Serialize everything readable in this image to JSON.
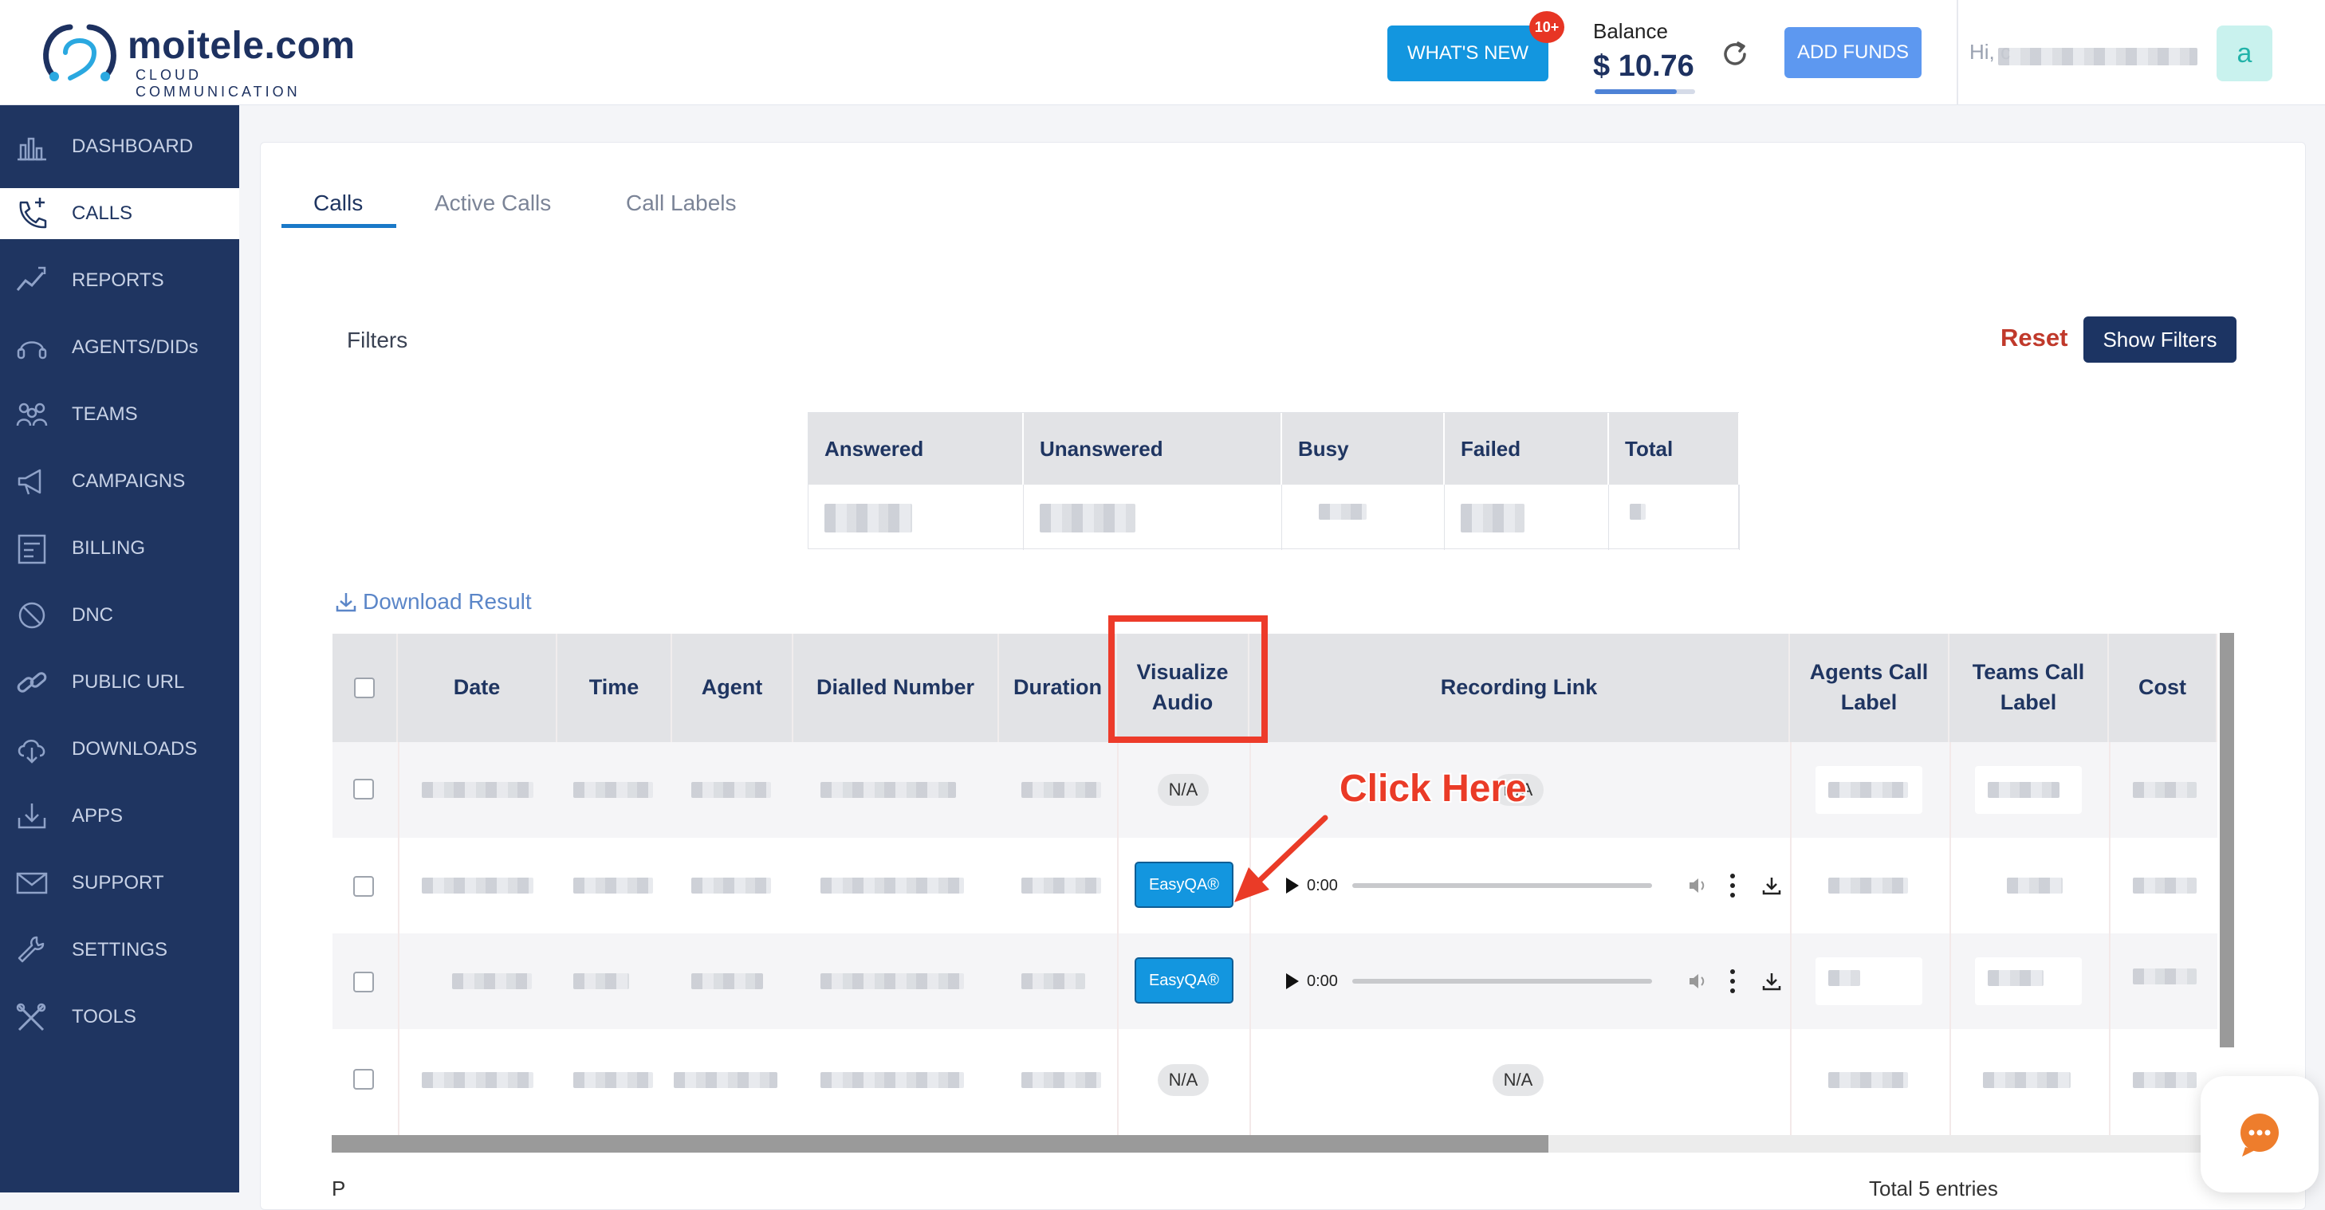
{
  "header": {
    "logo_text": "moitele.com",
    "logo_sub": "CLOUD COMMUNICATION",
    "whats_new": "WHAT'S NEW",
    "whats_new_badge": "10+",
    "balance_label": "Balance",
    "balance_value": "$ 10.76",
    "balance_fill": 0.82,
    "add_funds": "ADD FUNDS",
    "greeting": "Hi, c",
    "avatar_letter": "a",
    "brand_color": "#1f3561",
    "accent_color": "#1396df"
  },
  "sidebar": {
    "items": [
      {
        "label": "DASHBOARD",
        "icon": "dashboard-icon"
      },
      {
        "label": "CALLS",
        "icon": "phone-icon",
        "active": true
      },
      {
        "label": "REPORTS",
        "icon": "reports-icon"
      },
      {
        "label": "AGENTS/DIDs",
        "icon": "headset-icon"
      },
      {
        "label": "TEAMS",
        "icon": "teams-icon"
      },
      {
        "label": "CAMPAIGNS",
        "icon": "megaphone-icon"
      },
      {
        "label": "BILLING",
        "icon": "billing-icon"
      },
      {
        "label": "DNC",
        "icon": "block-icon"
      },
      {
        "label": "PUBLIC URL",
        "icon": "link-icon"
      },
      {
        "label": "DOWNLOADS",
        "icon": "cloud-download-icon"
      },
      {
        "label": "APPS",
        "icon": "apps-download-icon"
      },
      {
        "label": "SUPPORT",
        "icon": "mail-icon"
      },
      {
        "label": "SETTINGS",
        "icon": "wrench-icon"
      },
      {
        "label": "TOOLS",
        "icon": "tools-icon"
      }
    ]
  },
  "tabs": [
    "Calls",
    "Active Calls",
    "Call Labels"
  ],
  "filters": {
    "label": "Filters",
    "reset": "Reset",
    "show": "Show Filters"
  },
  "summary": {
    "headers": [
      "Answered",
      "Unanswered",
      "Busy",
      "Failed",
      "Total"
    ]
  },
  "download_result": "Download Result",
  "table": {
    "headers": [
      "Date",
      "Time",
      "Agent",
      "Dialled Number",
      "Duration",
      "Visualize Audio",
      "Recording Link",
      "Agents Call Label",
      "Teams Call Label",
      "Cost"
    ],
    "na": "N/A",
    "easyqa": "EasyQA®",
    "player_time": "0:00"
  },
  "annotation": {
    "text": "Click Here"
  },
  "footer": {
    "left": "P",
    "right": "Total 5 entries"
  }
}
